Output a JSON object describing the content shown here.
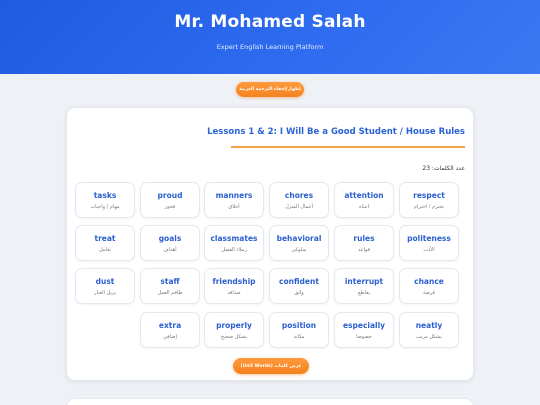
{
  "header": {
    "title": "Mr. Mohamed Salah",
    "subtitle": "Expert English Learning Platform"
  },
  "toggle_button": "إظهار/إخفاء الترجمة العربية",
  "lesson": {
    "title": "Lessons 1 & 2: I Will Be a Good Student / House Rules",
    "word_count": "عدد الكلمات: 23",
    "unit_button": "عرض كلمات (Unit Words)",
    "words": [
      {
        "en": "respect",
        "ar": "يحترم / احترام"
      },
      {
        "en": "attention",
        "ar": "انتباه"
      },
      {
        "en": "chores",
        "ar": "أعمال المنزل"
      },
      {
        "en": "manners",
        "ar": "أخلاق"
      },
      {
        "en": "proud",
        "ar": "فخور"
      },
      {
        "en": "tasks",
        "ar": "مهام / واجبات"
      },
      {
        "en": "politeness",
        "ar": "الأدب"
      },
      {
        "en": "rules",
        "ar": "قواعد"
      },
      {
        "en": "behavioral",
        "ar": "سلوكي"
      },
      {
        "en": "classmates",
        "ar": "زملاء الفصل"
      },
      {
        "en": "goals",
        "ar": "أهداف"
      },
      {
        "en": "treat",
        "ar": "يعامل"
      },
      {
        "en": "chance",
        "ar": "فرصة"
      },
      {
        "en": "interrupt",
        "ar": "يقاطع"
      },
      {
        "en": "confident",
        "ar": "واثق"
      },
      {
        "en": "friendship",
        "ar": "صداقة"
      },
      {
        "en": "staff",
        "ar": "طاقم العمل"
      },
      {
        "en": "dust",
        "ar": "يزيل الغبار"
      },
      {
        "en": "neatly",
        "ar": "بشكل مرتب"
      },
      {
        "en": "especially",
        "ar": "خصوصا"
      },
      {
        "en": "position",
        "ar": "مكانة"
      },
      {
        "en": "properly",
        "ar": "بشكل صحيح"
      },
      {
        "en": "extra",
        "ar": "إضافي"
      }
    ]
  },
  "colors": {
    "header": "#1e5be0",
    "accent_orange": "#f5821f",
    "word_blue": "#2a5fcf"
  }
}
